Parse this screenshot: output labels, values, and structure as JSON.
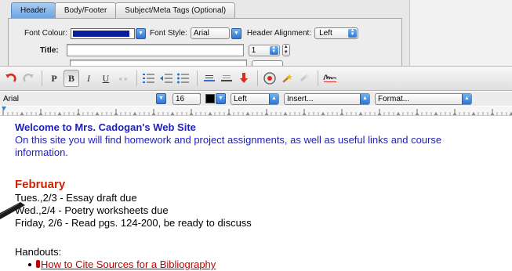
{
  "settings": {
    "tabs": [
      {
        "label": "Header",
        "active": true
      },
      {
        "label": "Body/Footer",
        "active": false
      },
      {
        "label": "Subject/Meta Tags (Optional)",
        "active": false
      }
    ],
    "font_colour_label": "Font Colour:",
    "font_colour_value": "#0a1ea0",
    "font_style_label": "Font Style:",
    "font_style_value": "Arial",
    "header_alignment_label": "Header Alignment:",
    "header_alignment_value": "Left",
    "title_label": "Title:",
    "title_value": "",
    "title_size_value": "1"
  },
  "toolbar": {
    "bold_label": "B",
    "italic_label": "I",
    "underline_label": "U",
    "paragraph_label": "P",
    "quote_label": "« »"
  },
  "formatbar": {
    "font_value": "Arial",
    "size_value": "16",
    "align_value": "Left",
    "insert_value": "Insert...",
    "format_value": "Format..."
  },
  "document": {
    "welcome_heading": "Welcome to Mrs. Cadogan's Web Site",
    "intro_line1": "On this site you will find homework and project assignments, as well as useful links and course",
    "intro_line2": "information.",
    "month_heading": "February",
    "assignments": [
      "Tues.,2/3 - Essay draft due",
      "Wed.,2/4 - Poetry worksheets due",
      "Friday, 2/6 - Read pgs. 124-200, be ready to discuss"
    ],
    "handouts_label": "Handouts:",
    "handout_link": "How to Cite Sources for a Bibliography"
  },
  "colors": {
    "heading_blue": "#1d1fb8",
    "month_red": "#cc2200",
    "link_red": "#c00000"
  }
}
